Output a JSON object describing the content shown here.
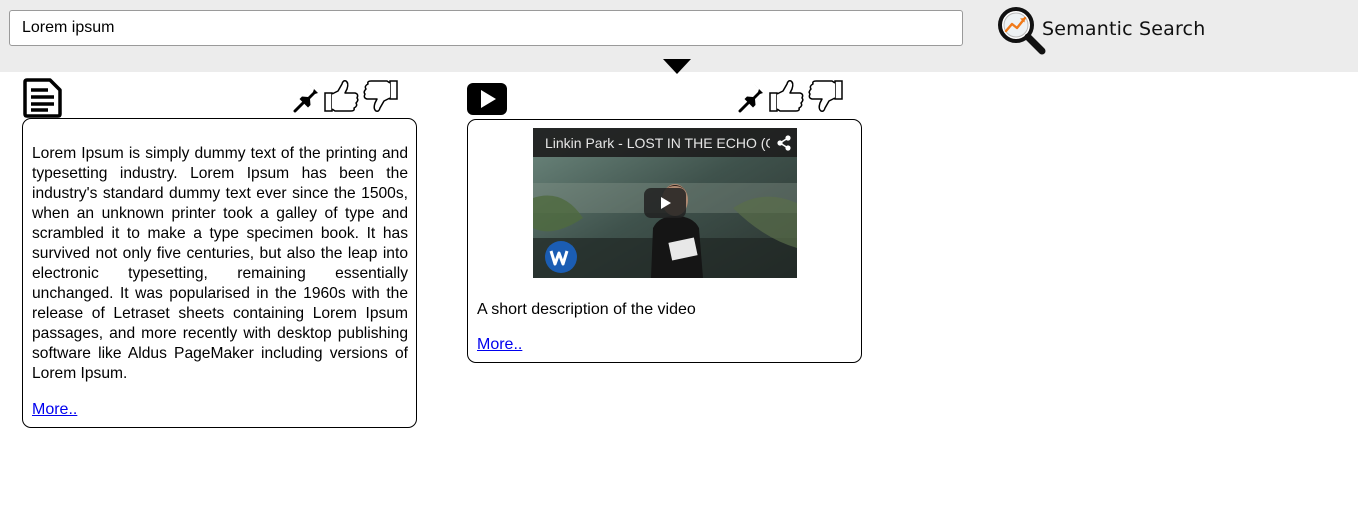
{
  "header": {
    "search": {
      "value": "Lorem ipsum",
      "placeholder": ""
    },
    "logo": {
      "text": "Semantic Search",
      "icon": "magnifier-trend-icon"
    },
    "toggle_icon": "triangle-down-icon"
  },
  "results": [
    {
      "type": "document",
      "type_icon": "document-icon",
      "actions": [
        "pin-icon",
        "thumbs-up-icon",
        "thumbs-down-icon"
      ],
      "text": "Lorem Ipsum is simply dummy text of the printing and typesetting industry. Lorem Ipsum has been the industry's standard dummy text ever since the 1500s, when an unknown printer took a galley of type and scrambled it to make a type specimen book. It has survived not only five centuries, but also the leap into electronic typesetting, remaining essentially unchanged. It was popularised in the 1960s with the release of Letraset sheets containing Lorem Ipsum passages, and more recently with desktop publishing software like Aldus PageMaker including versions of Lorem Ipsum.",
      "more_label": "More.."
    },
    {
      "type": "video",
      "type_icon": "video-play-icon",
      "actions": [
        "pin-icon",
        "thumbs-up-icon",
        "thumbs-down-icon"
      ],
      "video_title": "Linkin Park - LOST IN THE ECHO (O...",
      "description": "A short description of the video",
      "more_label": "More.."
    }
  ],
  "colors": {
    "topbar": "#ececec",
    "link": "#0000ee",
    "logo_accent": "#f07a1a"
  }
}
